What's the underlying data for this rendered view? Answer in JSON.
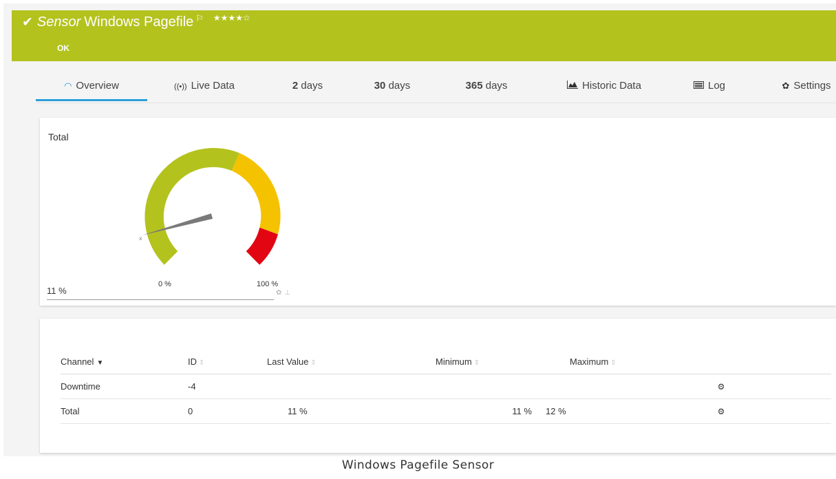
{
  "header": {
    "title_type": "Sensor",
    "title_name": "Windows Pagefile",
    "stars": "★★★★☆",
    "status": "OK",
    "color": "#b4c21e"
  },
  "tabs": [
    {
      "label": "Overview",
      "icon": "gauge-icon"
    },
    {
      "label": "Live Data",
      "icon": "live-data-icon"
    },
    {
      "num": "2",
      "unit": "days"
    },
    {
      "num": "30",
      "unit": "days"
    },
    {
      "num": "365",
      "unit": "days"
    },
    {
      "label": "Historic Data",
      "icon": "area-chart-icon"
    },
    {
      "label": "Log",
      "icon": "log-icon"
    },
    {
      "label": "Settings",
      "icon": "gear-icon"
    }
  ],
  "gauge": {
    "title": "Total",
    "last_value": "11 %",
    "min_label": "0 %",
    "max_label": "100 %",
    "value_fraction": 0.11,
    "colors": {
      "ok": "#b4c21e",
      "warning": "#f5c200",
      "error": "#e20613"
    }
  },
  "table": {
    "columns": [
      "Channel",
      "ID",
      "Last Value",
      "Minimum",
      "Maximum"
    ],
    "rows": [
      {
        "channel": "Downtime",
        "id": "-4",
        "last": "",
        "min": "",
        "max": ""
      },
      {
        "channel": "Total",
        "id": "0",
        "last": "11 %",
        "min": "11 %",
        "max": "12 %"
      }
    ]
  },
  "caption": "Windows Pagefile Sensor"
}
